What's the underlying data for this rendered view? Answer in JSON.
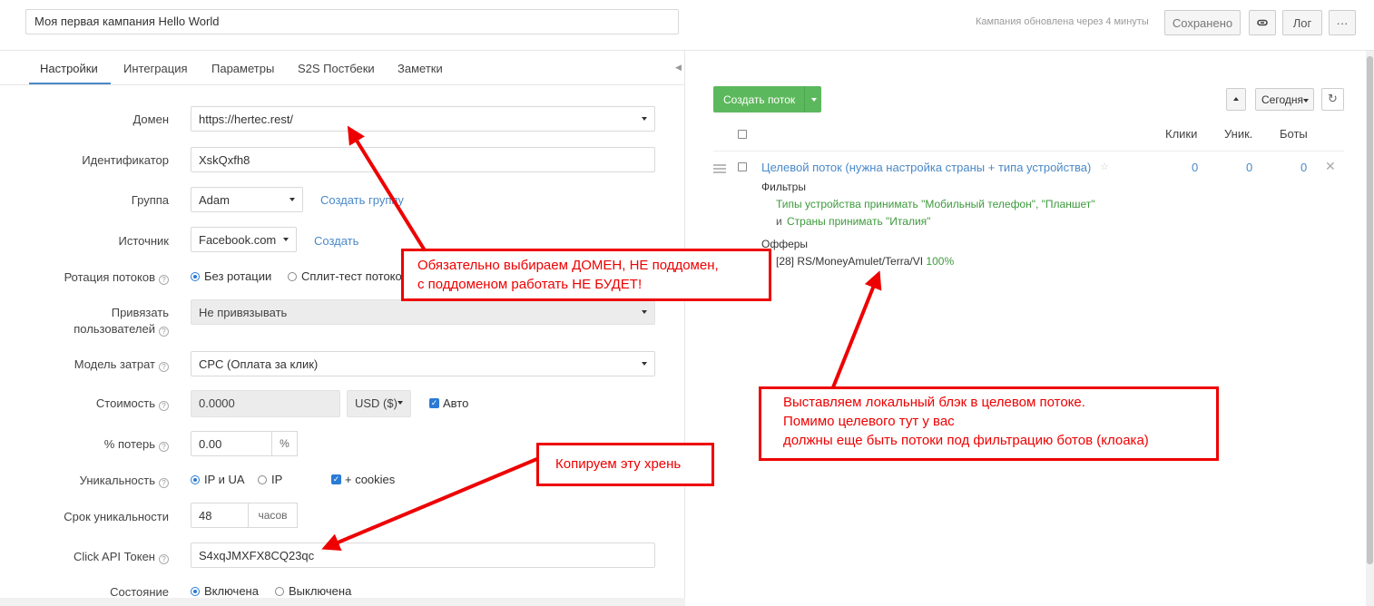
{
  "header": {
    "campaign_name": "Моя первая кампания Hello World",
    "updated_text": "Кампания обновлена через 4 минуты",
    "saved_label": "Сохранено",
    "link_icon": "link-icon",
    "log_label": "Лог",
    "more_label": "···"
  },
  "tabs": [
    {
      "label": "Настройки",
      "active": true
    },
    {
      "label": "Интеграция"
    },
    {
      "label": "Параметры"
    },
    {
      "label": "S2S Постбеки"
    },
    {
      "label": "Заметки"
    }
  ],
  "form": {
    "domain": {
      "label": "Домен",
      "value": "https://hertec.rest/"
    },
    "identifier": {
      "label": "Идентификатор",
      "value": "XskQxfh8"
    },
    "group": {
      "label": "Группа",
      "value": "Adam",
      "link": "Создать группу"
    },
    "source": {
      "label": "Источник",
      "value": "Facebook.com",
      "link": "Создать"
    },
    "rotation": {
      "label": "Ротация потоков",
      "opt1": "Без ротации",
      "opt2": "Сплит-тест потоков"
    },
    "bind_users": {
      "label_line1": "Привязать",
      "label_line2": "пользователей",
      "value": "Не привязывать"
    },
    "cost_model": {
      "label": "Модель затрат",
      "value": "CPC (Оплата за клик)"
    },
    "cost": {
      "label": "Стоимость",
      "value": "0.0000",
      "currency": "USD ($)",
      "auto": "Авто"
    },
    "loss": {
      "label": "% потерь",
      "value": "0.00",
      "unit": "%"
    },
    "uniqueness": {
      "label": "Уникальность",
      "opt1": "IP и UA",
      "opt2": "IP",
      "cookies": "+ cookies"
    },
    "uniq_period": {
      "label": "Срок уникальности",
      "value": "48",
      "unit": "часов"
    },
    "api_token": {
      "label": "Click API Токен",
      "value": "S4xqJMXFX8CQ23qc"
    },
    "state": {
      "label": "Состояние",
      "opt1": "Включена",
      "opt2": "Выключена"
    }
  },
  "flows": {
    "create_label": "Создать поток",
    "today_label": "Сегодня",
    "refresh_icon": "refresh-icon",
    "col_clicks": "Клики",
    "col_unique": "Уник.",
    "col_bots": "Боты",
    "flow": {
      "title": "Целевой поток (нужна настройка страны + типа устройства)",
      "clicks": "0",
      "unique": "0",
      "bots": "0",
      "filters_label": "Фильтры",
      "filter1": "Типы устройства принимать \"Мобильный телефон\", \"Планшет\"",
      "filter_and": "и",
      "filter2": "Страны принимать \"Италия\"",
      "offers_label": "Офферы",
      "offer": "[28] RS/MoneyAmulet/Terra/VI",
      "offer_share": "100%"
    }
  },
  "annotations": {
    "domain_note_line1": "Обязательно выбираем ДОМЕН, НЕ поддомен,",
    "domain_note_line2": "с поддоменом работать НЕ БУДЕТ!",
    "copy_note": "Копируем эту хрень",
    "flow_note_line1": "Выставляем локальный блэк в целевом потоке.",
    "flow_note_line2": "Помимо целевого тут у вас",
    "flow_note_line3": "должны еще быть потоки под фильтрацию ботов (клоака)"
  },
  "colors": {
    "accent": "#4a89c8",
    "green": "#5cb85c",
    "annotation": "#e00000"
  }
}
